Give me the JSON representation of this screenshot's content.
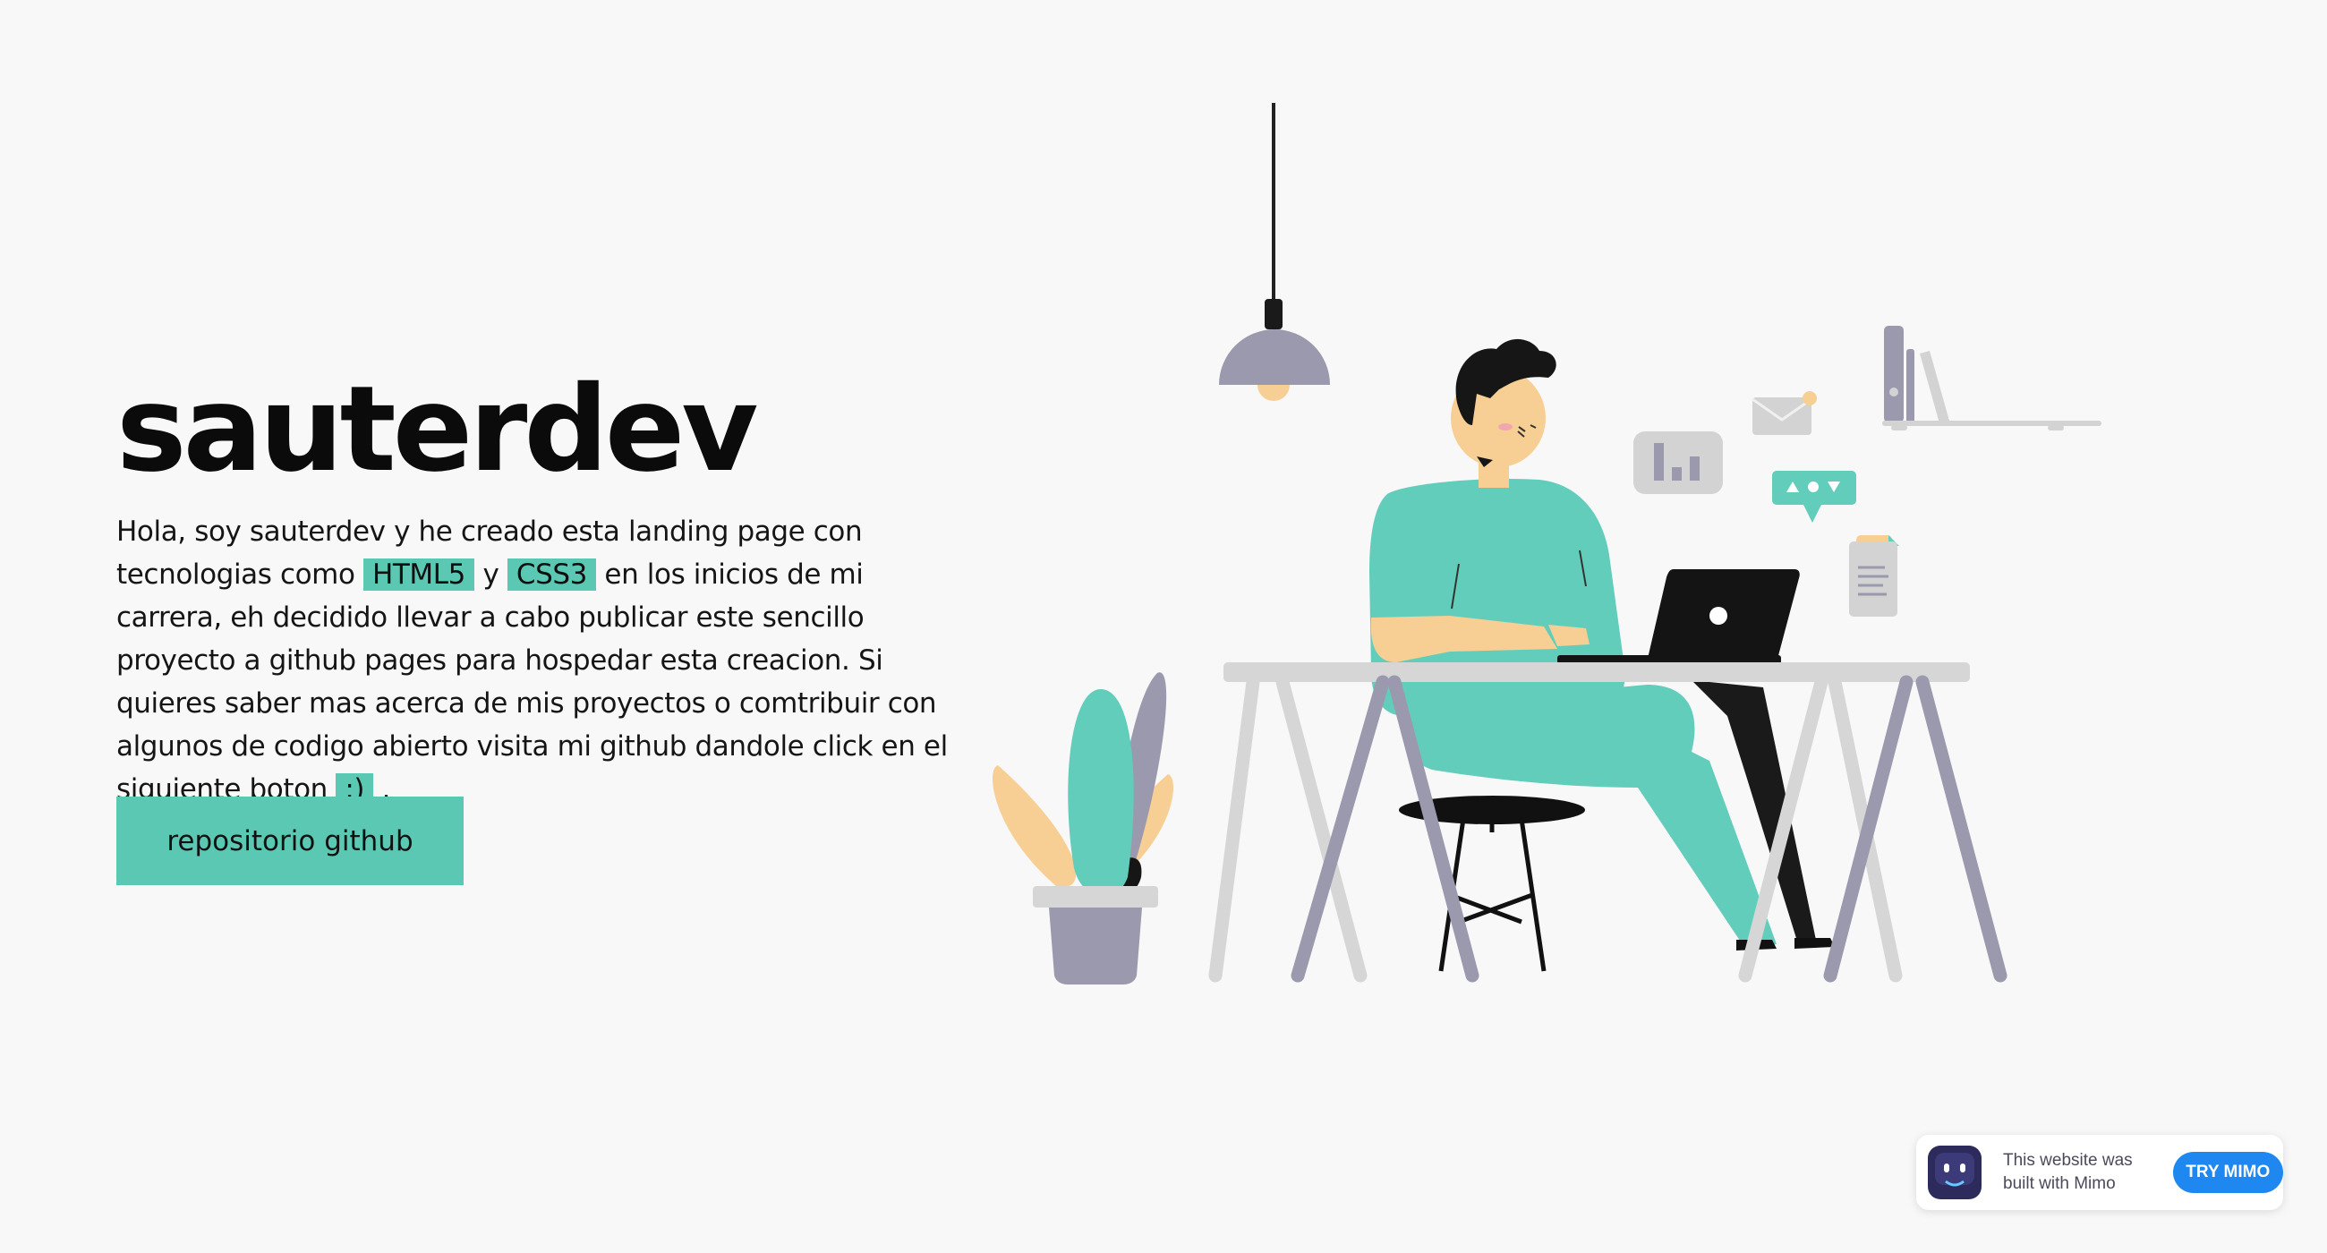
{
  "hero": {
    "title": "sauterdev",
    "intro": {
      "part1": "Hola, soy sauterdev y he creado esta landing page con tecnologias como ",
      "tag1": "HTML5",
      "part2": " y ",
      "tag2": "CSS3",
      "part3": " en los inicios de mi carrera, eh decidido llevar a cabo publicar este sencillo proyecto a github pages para hospedar esta creacion. Si quieres saber mas acerca de mis proyectos o comtribuir con algunos de codigo abierto visita mi github dandole click en el siguiente boton ",
      "tag3": ":)",
      "part4": " ."
    },
    "button_label": "repositorio github"
  },
  "illustration": {
    "icons": [
      "desk-lamp-icon",
      "chart-card-icon",
      "envelope-icon",
      "chat-bubble-icon",
      "document-icon",
      "shelf-icon",
      "plant-icon",
      "laptop-icon"
    ]
  },
  "mimo_badge": {
    "line1": "This website was",
    "line2": "built with Mimo",
    "button_label": "TRY MIMO"
  },
  "colors": {
    "background": "#f8f8f8",
    "accent": "#5bc8b4",
    "mimo_button": "#1e88f0"
  }
}
